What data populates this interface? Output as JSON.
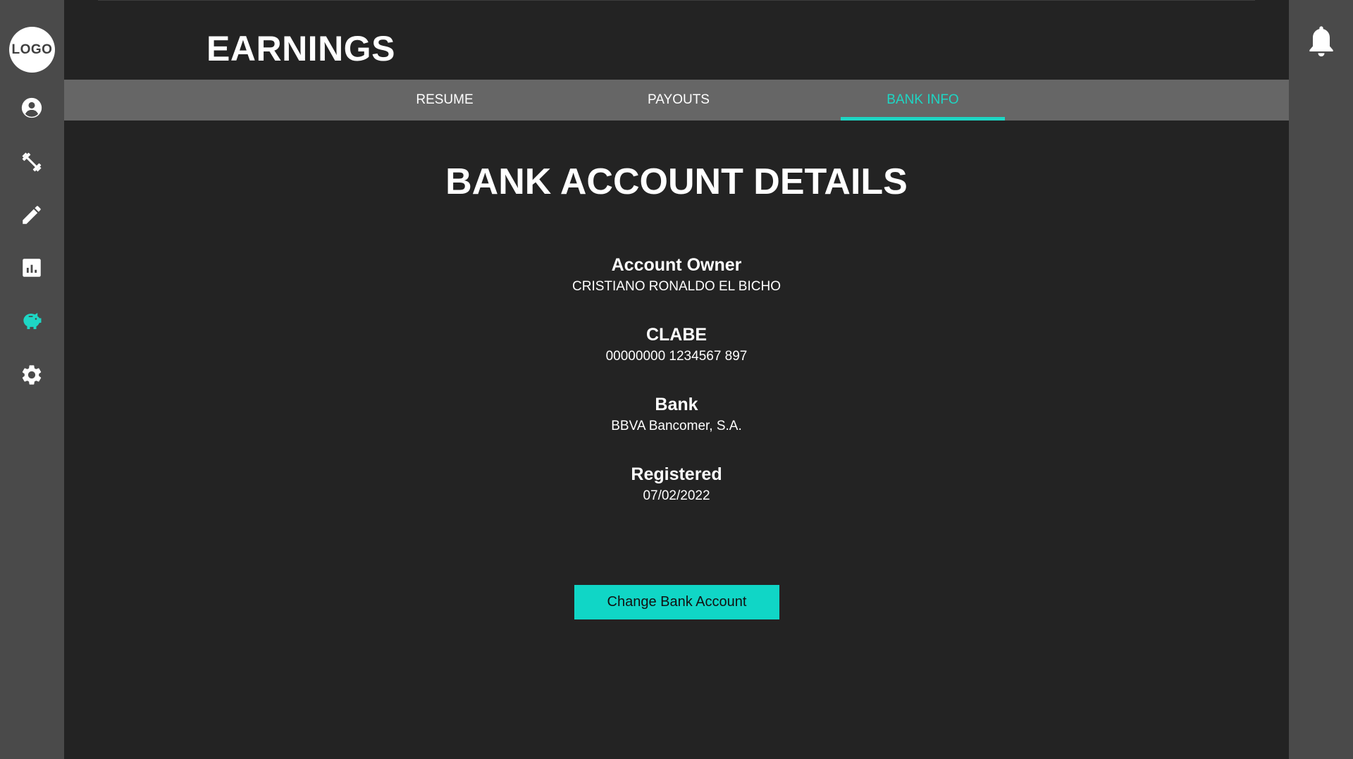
{
  "sidebar": {
    "logo_text": "LOGO",
    "items": [
      {
        "icon": "profile-icon",
        "active": false
      },
      {
        "icon": "workout-icon",
        "active": false
      },
      {
        "icon": "edit-icon",
        "active": false
      },
      {
        "icon": "stats-icon",
        "active": false
      },
      {
        "icon": "piggy-bank-icon",
        "active": true
      },
      {
        "icon": "gear-icon",
        "active": false
      }
    ]
  },
  "header": {
    "title": "EARNINGS",
    "notification_icon": "bell-icon"
  },
  "tabs": [
    {
      "label": "RESUME",
      "active": false
    },
    {
      "label": "PAYOUTS",
      "active": false
    },
    {
      "label": "BANK INFO",
      "active": true
    }
  ],
  "bank": {
    "title": "BANK ACCOUNT DETAILS",
    "fields": [
      {
        "label": "Account Owner",
        "value": "CRISTIANO RONALDO EL BICHO"
      },
      {
        "label": "CLABE",
        "value": "00000000 1234567 897"
      },
      {
        "label": "Bank",
        "value": "BBVA Bancomer, S.A."
      },
      {
        "label": "Registered",
        "value": "07/02/2022"
      }
    ],
    "change_button": "Change Bank Account"
  },
  "colors": {
    "accent": "#1ed6c4",
    "sidebar_bg": "#4a4a4a",
    "main_bg": "#232323",
    "tabbar_bg": "#666666"
  }
}
